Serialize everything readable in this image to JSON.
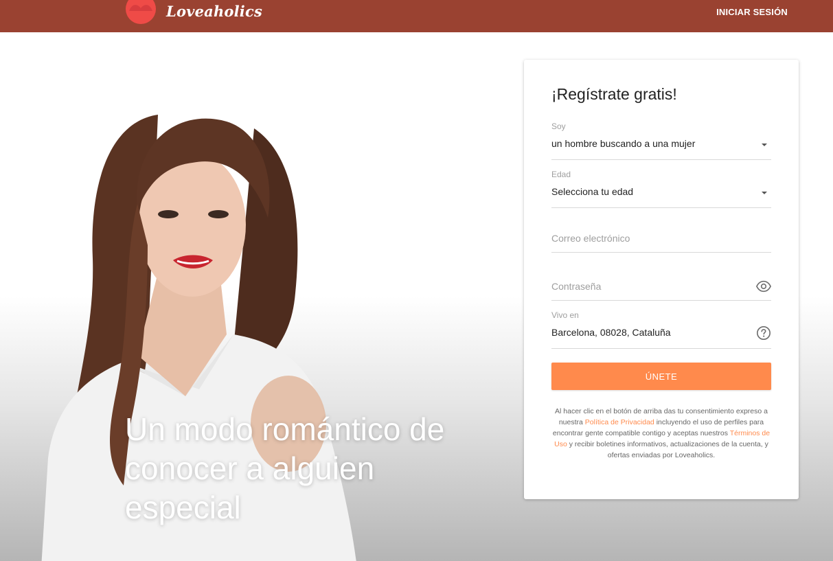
{
  "header": {
    "brand": "Loveaholics",
    "login_label": "INICIAR SESIÓN",
    "background_color": "#9a4231"
  },
  "hero": {
    "tagline": "Un modo romántico de conocer a alguien especial"
  },
  "signup": {
    "title": "¡Regístrate gratis!",
    "fields": {
      "gender": {
        "label": "Soy",
        "value": "un hombre buscando a una mujer",
        "icon": "chevron-down-icon"
      },
      "age": {
        "label": "Edad",
        "value": "Selecciona tu edad",
        "icon": "chevron-down-icon"
      },
      "email": {
        "placeholder": "Correo electrónico"
      },
      "password": {
        "placeholder": "Contraseña",
        "icon": "eye-icon"
      },
      "location": {
        "label": "Vivo en",
        "value": "Barcelona, 08028, Cataluña",
        "icon": "help-circle-icon"
      }
    },
    "submit_label": "ÚNETE",
    "accent_color": "#ff8a4c",
    "legal": {
      "part1": "Al hacer clic en el botón de arriba das tu consentimiento expreso a nuestra ",
      "privacy_link": "Política de Privacidad",
      "part2": " incluyendo el uso de perfiles para encontrar gente compatible contigo y aceptas nuestros ",
      "terms_link": "Términos de Uso",
      "part3": " y recibir boletines informativos, actualizaciones de la cuenta, y ofertas enviadas por Loveaholics."
    }
  }
}
